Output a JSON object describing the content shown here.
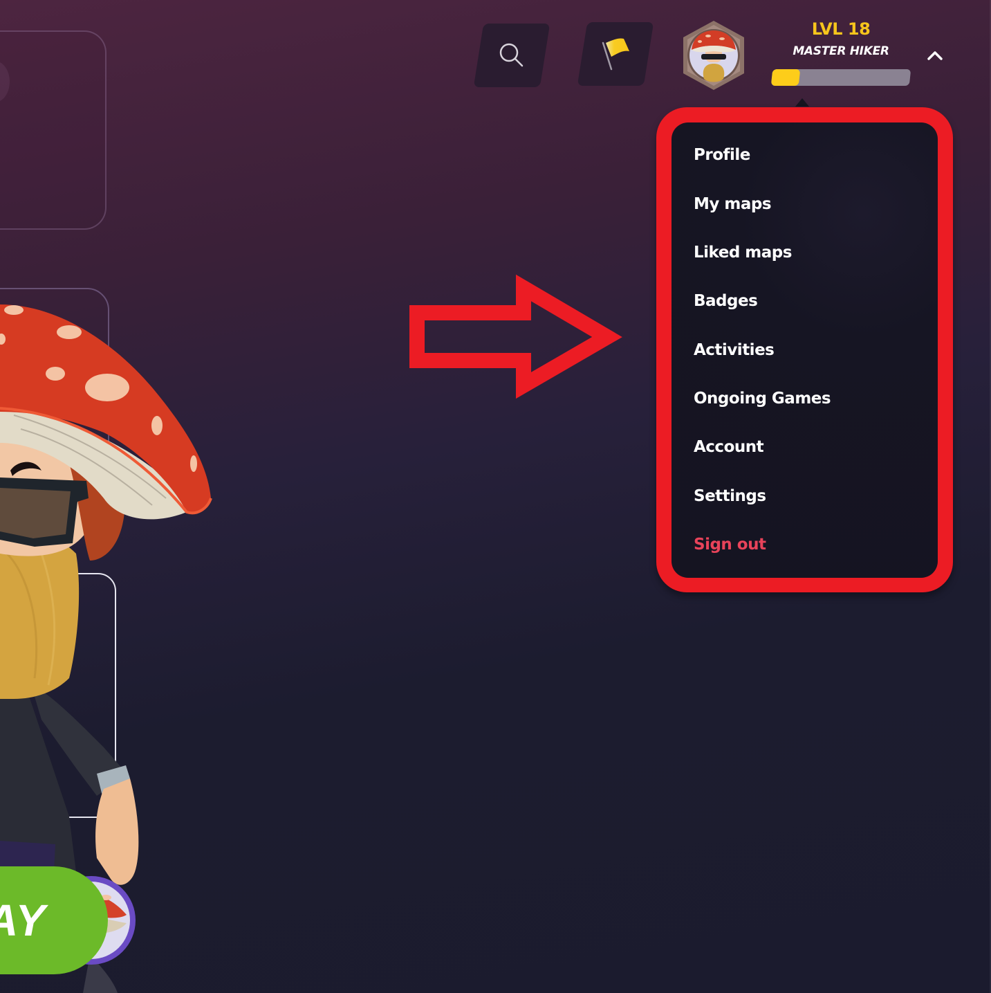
{
  "header": {
    "search_button": {
      "icon": "search-icon"
    },
    "flag_button": {
      "icon": "flag-icon"
    },
    "profile": {
      "avatar_icon": "mushroom-avatar",
      "level": "LVL 18",
      "rank_title": "MASTER HIKER",
      "xp_progress_fraction": 0.2,
      "collapse_icon": "chevron-up-icon"
    }
  },
  "dropdown": {
    "items": [
      {
        "label": "Profile"
      },
      {
        "label": "My maps"
      },
      {
        "label": "Liked maps"
      },
      {
        "label": "Badges"
      },
      {
        "label": "Activities"
      },
      {
        "label": "Ongoing Games"
      },
      {
        "label": "Account"
      },
      {
        "label": "Settings"
      },
      {
        "label": "Sign out",
        "variant": "danger"
      }
    ]
  },
  "main": {
    "play_button_label": "AY"
  },
  "annotation": {
    "arrow_direction": "right",
    "highlight": "dropdown-menu"
  },
  "colors": {
    "accent_yellow": "#f6c51c",
    "xp_fill": "#fdcd1a",
    "xp_track": "#8a8292",
    "annotation_red": "#ec1c24",
    "sign_out_red": "#e8435a",
    "play_green": "#6cba29",
    "menu_bg": "#151421",
    "bg_top": "#4d2540",
    "bg_bottom": "#1b1b2e"
  }
}
